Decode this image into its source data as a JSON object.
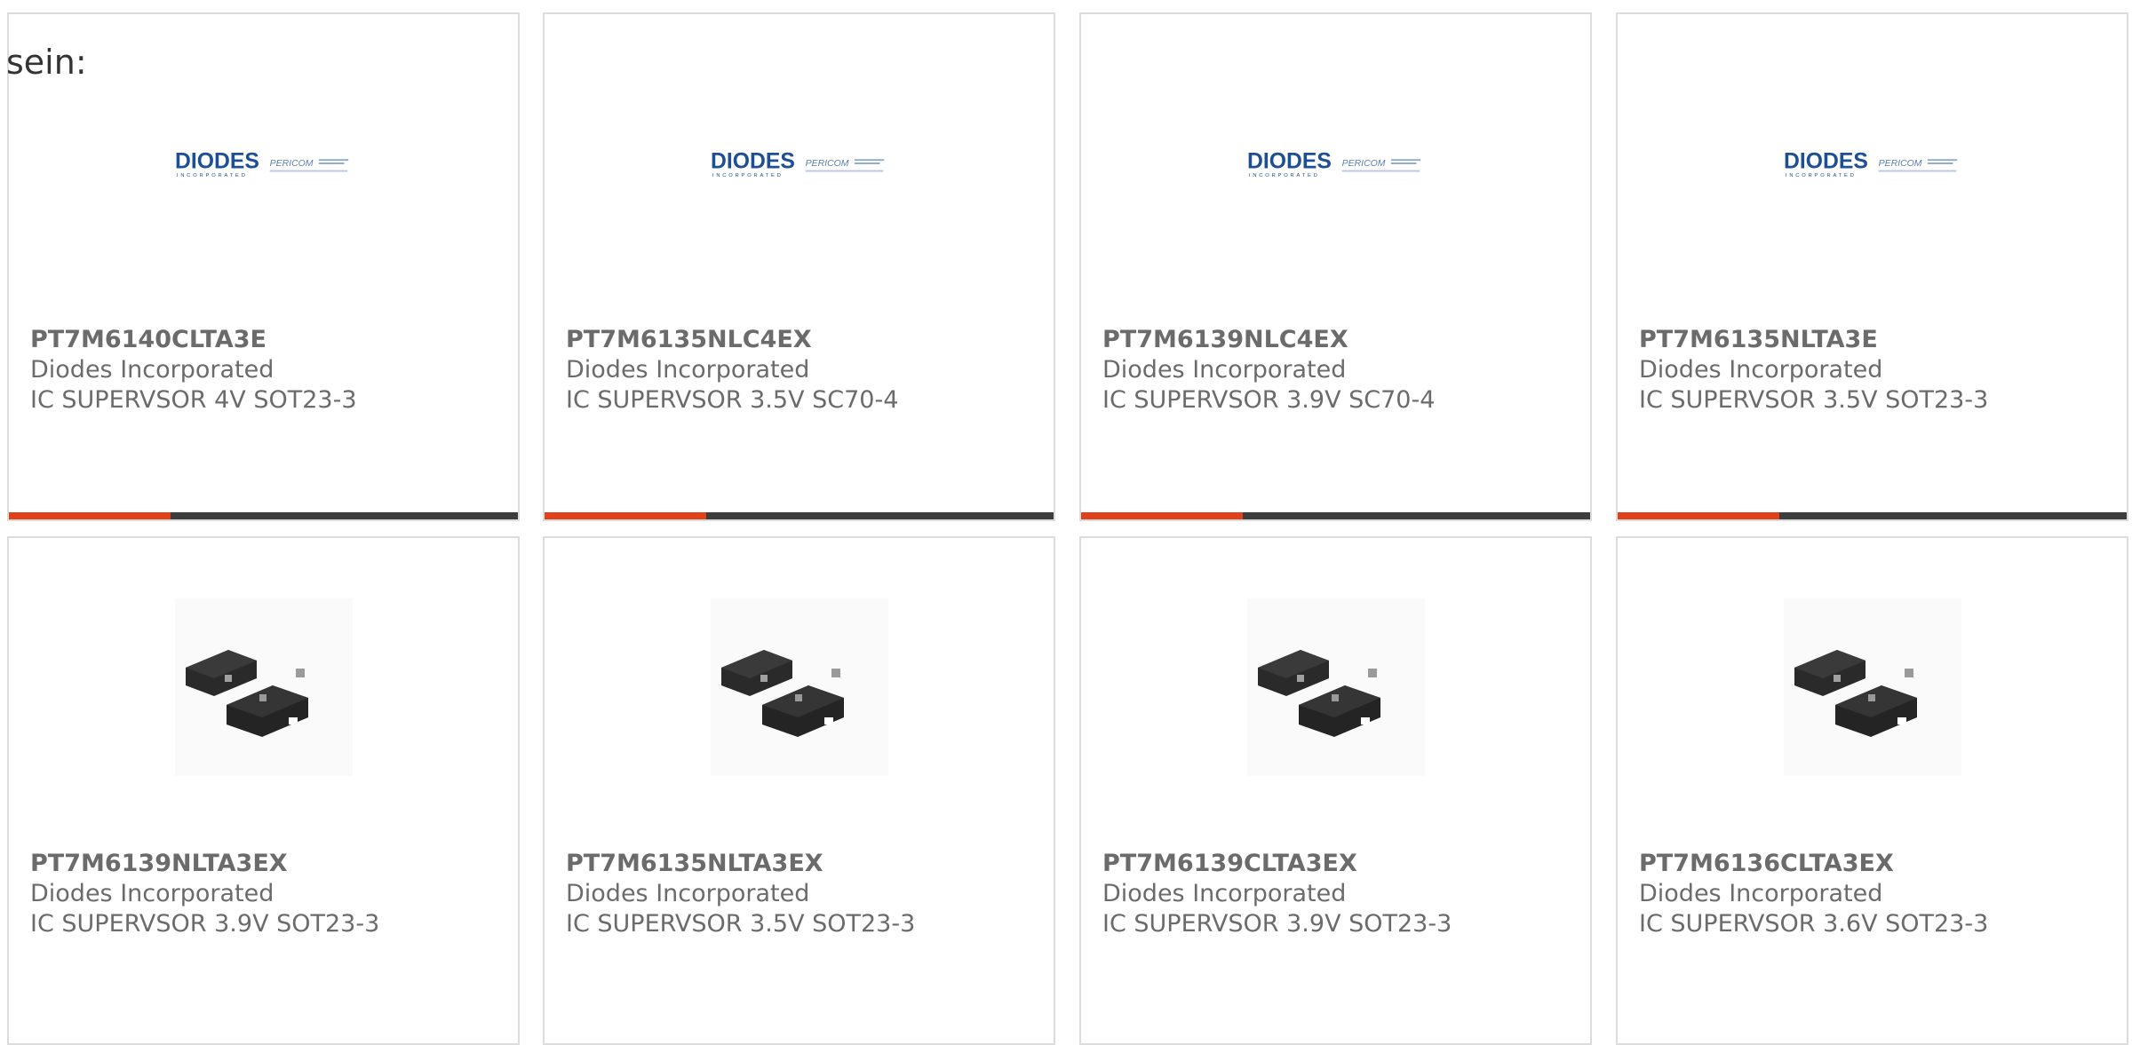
{
  "intro_text": "sein:",
  "colors": {
    "accent": "#e0401a",
    "bar": "#3d3d3d",
    "card_border": "#dcdcdc",
    "text": "#6b6b6b",
    "logo_blue": "#1c4f95"
  },
  "logo": {
    "brand": "DIODES",
    "sub": "INCORPORATED",
    "partner": "PERICOM"
  },
  "products": [
    {
      "part_number": "PT7M6140CLTA3E",
      "manufacturer": "Diodes Incorporated",
      "description": "IC SUPERVSOR 4V SOT23-3",
      "image": "diodes-logo"
    },
    {
      "part_number": "PT7M6135NLC4EX",
      "manufacturer": "Diodes Incorporated",
      "description": "IC SUPERVSOR 3.5V SC70-4",
      "image": "diodes-logo"
    },
    {
      "part_number": "PT7M6139NLC4EX",
      "manufacturer": "Diodes Incorporated",
      "description": "IC SUPERVSOR 3.9V SC70-4",
      "image": "diodes-logo"
    },
    {
      "part_number": "PT7M6135NLTA3E",
      "manufacturer": "Diodes Incorporated",
      "description": "IC SUPERVSOR 3.5V SOT23-3",
      "image": "diodes-logo"
    },
    {
      "part_number": "PT7M6139NLTA3EX",
      "manufacturer": "Diodes Incorporated",
      "description": "IC SUPERVSOR 3.9V SOT23-3",
      "image": "sot23-package"
    },
    {
      "part_number": "PT7M6135NLTA3EX",
      "manufacturer": "Diodes Incorporated",
      "description": "IC SUPERVSOR 3.5V SOT23-3",
      "image": "sot23-package"
    },
    {
      "part_number": "PT7M6139CLTA3EX",
      "manufacturer": "Diodes Incorporated",
      "description": "IC SUPERVSOR 3.9V SOT23-3",
      "image": "sot23-package"
    },
    {
      "part_number": "PT7M6136CLTA3EX",
      "manufacturer": "Diodes Incorporated",
      "description": "IC SUPERVSOR 3.6V SOT23-3",
      "image": "sot23-package"
    }
  ]
}
